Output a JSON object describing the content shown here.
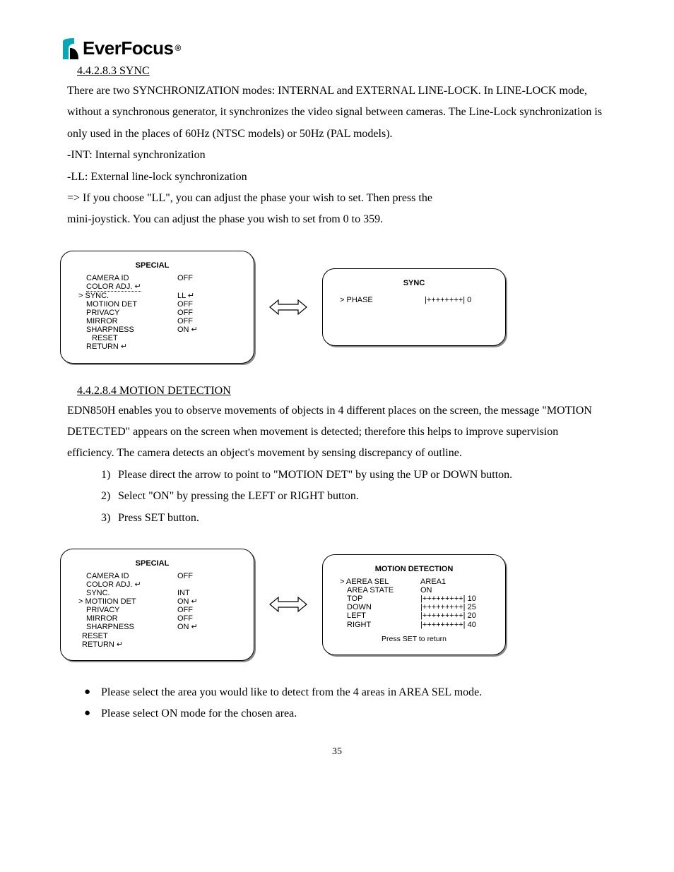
{
  "logo": {
    "text": "EverFocus",
    "reg": "®"
  },
  "section1": {
    "number_title": "4.4.2.8.3 SYNC",
    "para": "There are two SYNCHRONIZATION modes: INTERNAL and EXTERNAL LINE-LOCK. In LINE-LOCK mode, without a synchronous generator, it synchronizes the video signal between cameras. The Line-Lock synchronization is only used in the places of 60Hz (NTSC models) or 50Hz (PAL models).",
    "line_int": "-INT: Internal synchronization",
    "line_ll": "-LL: External line-lock synchronization",
    "line_ifll": "=> If you choose \"LL\", you can adjust the phase your wish to set. Then press the",
    "line_ifll2": "mini-joystick. You can adjust the phase you wish to set from 0 to 359."
  },
  "menu1": {
    "title": "SPECIAL",
    "rows": [
      {
        "label": "CAMERA ID",
        "val": "OFF",
        "sel": false
      },
      {
        "label": "COLOR ADJ. ↵",
        "val": "",
        "sel": false,
        "dotted": true
      },
      {
        "label": "> SYNC.",
        "val": "LL ↵",
        "sel": true
      },
      {
        "label": "MOTIION DET",
        "val": "OFF",
        "sel": false
      },
      {
        "label": "PRIVACY",
        "val": "OFF",
        "sel": false
      },
      {
        "label": "MIRROR",
        "val": "OFF",
        "sel": false
      },
      {
        "label": "SHARPNESS",
        "val": "ON ↵",
        "sel": false
      },
      {
        "label": "RESET",
        "val": "",
        "sel": false,
        "nest": true
      },
      {
        "label": "RETURN ↵",
        "val": "",
        "sel": false
      }
    ]
  },
  "rightbox1": {
    "title": "SYNC",
    "row": {
      "label": "> PHASE",
      "val": "|++++++++| 0"
    }
  },
  "section2": {
    "number_title": "4.4.2.8.4 MOTION DETECTION",
    "para": "EDN850H enables you to observe movements of objects in 4 different places on the screen, the message \"MOTION DETECTED\" appears on the screen when movement is detected; therefore this helps to improve supervision efficiency. The camera detects an object's movement by sensing discrepancy of outline.",
    "steps": [
      "Please direct the arrow to point to \"MOTION DET\" by using the UP or DOWN button.",
      "Select \"ON\" by pressing the LEFT or RIGHT button.",
      "Press SET button."
    ]
  },
  "menu2": {
    "title": "SPECIAL",
    "rows": [
      {
        "label": "CAMERA ID",
        "val": "OFF",
        "sel": false
      },
      {
        "label": "COLOR ADJ. ↵",
        "val": "",
        "sel": false
      },
      {
        "label": "SYNC.",
        "val": "INT",
        "sel": false
      },
      {
        "label": "> MOTIION DET",
        "val": "ON ↵",
        "sel": true
      },
      {
        "label": "PRIVACY",
        "val": "OFF",
        "sel": false
      },
      {
        "label": "MIRROR",
        "val": "OFF",
        "sel": false
      },
      {
        "label": "SHARPNESS",
        "val": "ON ↵",
        "sel": false
      },
      {
        "label": "RESET",
        "val": "",
        "sel": false,
        "split": true
      },
      {
        "label": "RETURN ↵",
        "val": "",
        "sel": false,
        "split": true
      }
    ]
  },
  "rightbox2": {
    "title": "MOTION DETECTION",
    "rows": [
      {
        "label": "> AEREA SEL",
        "val": "AREA1"
      },
      {
        "label": "AREA STATE",
        "val": "ON"
      },
      {
        "label": "TOP",
        "val": "|+++++++++| 10"
      },
      {
        "label": "DOWN",
        "val": "|+++++++++| 25"
      },
      {
        "label": "LEFT",
        "val": "|+++++++++| 20"
      },
      {
        "label": "RIGHT",
        "val": "|+++++++++| 40"
      }
    ],
    "footer": "Press SET to return"
  },
  "bullets": [
    "Please select the area you would like to detect from the 4 areas in AREA SEL mode.",
    "Please select ON mode for the chosen area."
  ],
  "page_number": "35"
}
